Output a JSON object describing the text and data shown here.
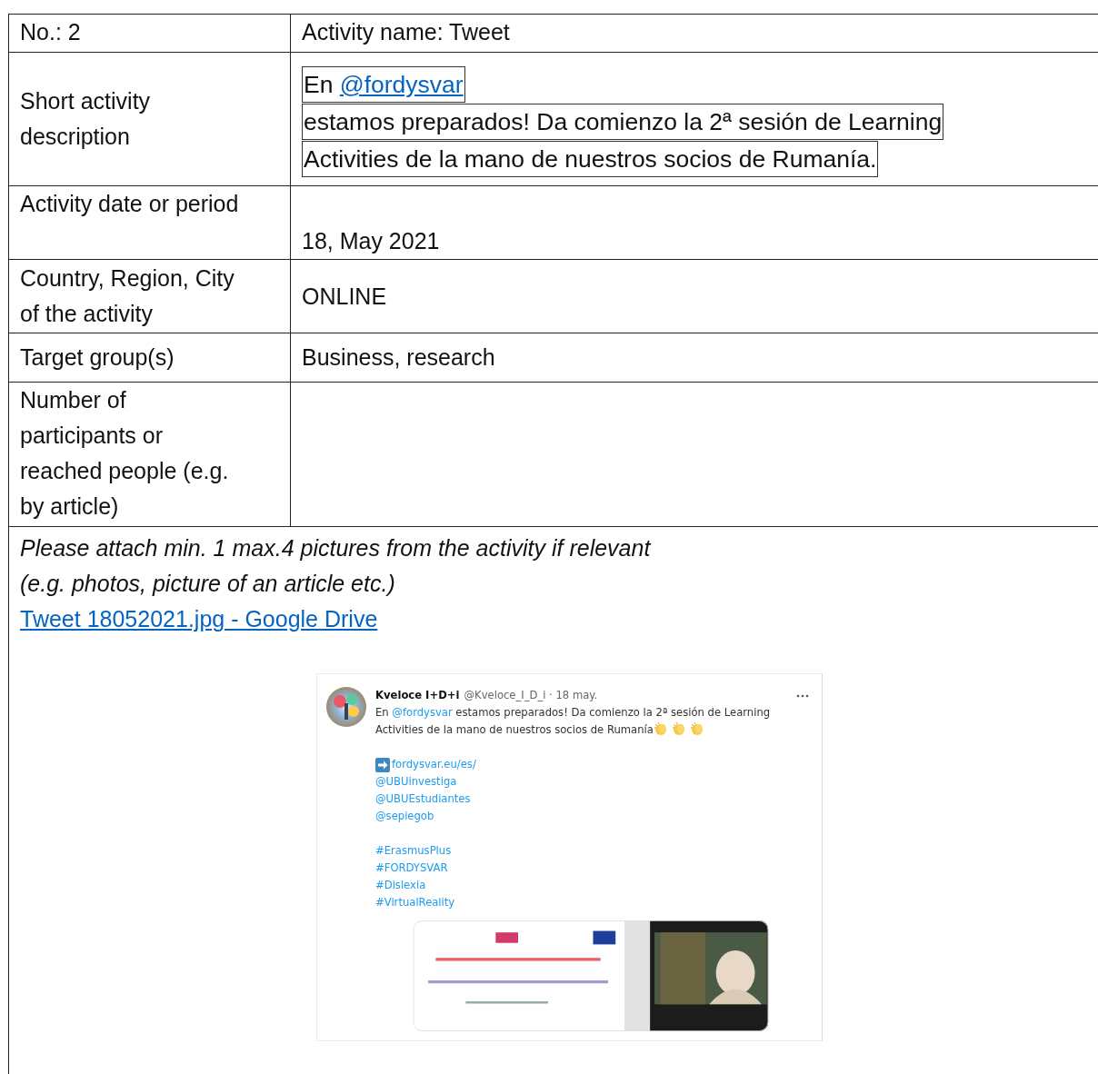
{
  "table": {
    "rows": [
      {
        "kind": "header",
        "label": "No.: 2",
        "value": "Activity name: Tweet"
      },
      {
        "kind": "description",
        "label": "Short activity description",
        "lines": [
          {
            "text": "En ",
            "link": "@fordysvar"
          },
          {
            "text": "estamos preparados! Da comienzo la 2ª sesión de Learning"
          },
          {
            "text": "Activities de la mano de nuestros socios de Rumanía."
          }
        ]
      },
      {
        "kind": "date",
        "label": "Activity date or period",
        "value": "18, May 2021"
      },
      {
        "kind": "place",
        "label": "Country, Region, City of the activity",
        "value": "ONLINE"
      },
      {
        "kind": "target",
        "label": "Target group(s)",
        "value": "Business, research"
      },
      {
        "kind": "count",
        "label": "Number of participants or reached people (e.g. by article)"
      }
    ]
  },
  "attachment": {
    "instruction_lines": [
      "Please attach min. 1 max.4 pictures from the activity if relevant",
      "(e.g. photos, picture of an article etc.)"
    ],
    "link": "Tweet 18052021.jpg - Google Drive",
    "tweet": {
      "author": "Kveloce I+D+i",
      "handle_date": "@Kveloce_I_D_i · 18 may.",
      "text_before": "En ",
      "mention": "@fordysvar",
      "text_after": " estamos preparados! Da comienzo la 2ª sesión de Learning Activities de la mano de nuestros socios de Rumanía",
      "link_lines": [
        {
          "kind": "url",
          "text": "fordysvar.eu/es/"
        },
        {
          "kind": "mention",
          "text": "@UBUinvestiga"
        },
        {
          "kind": "mention",
          "text": "@UBUEstudiantes"
        },
        {
          "kind": "mention",
          "text": "@sepiegob"
        }
      ],
      "hashtags": [
        "#ErasmusPlus",
        "#FORDYSVAR",
        "#Dislexia",
        "#VirtualReality"
      ]
    }
  }
}
